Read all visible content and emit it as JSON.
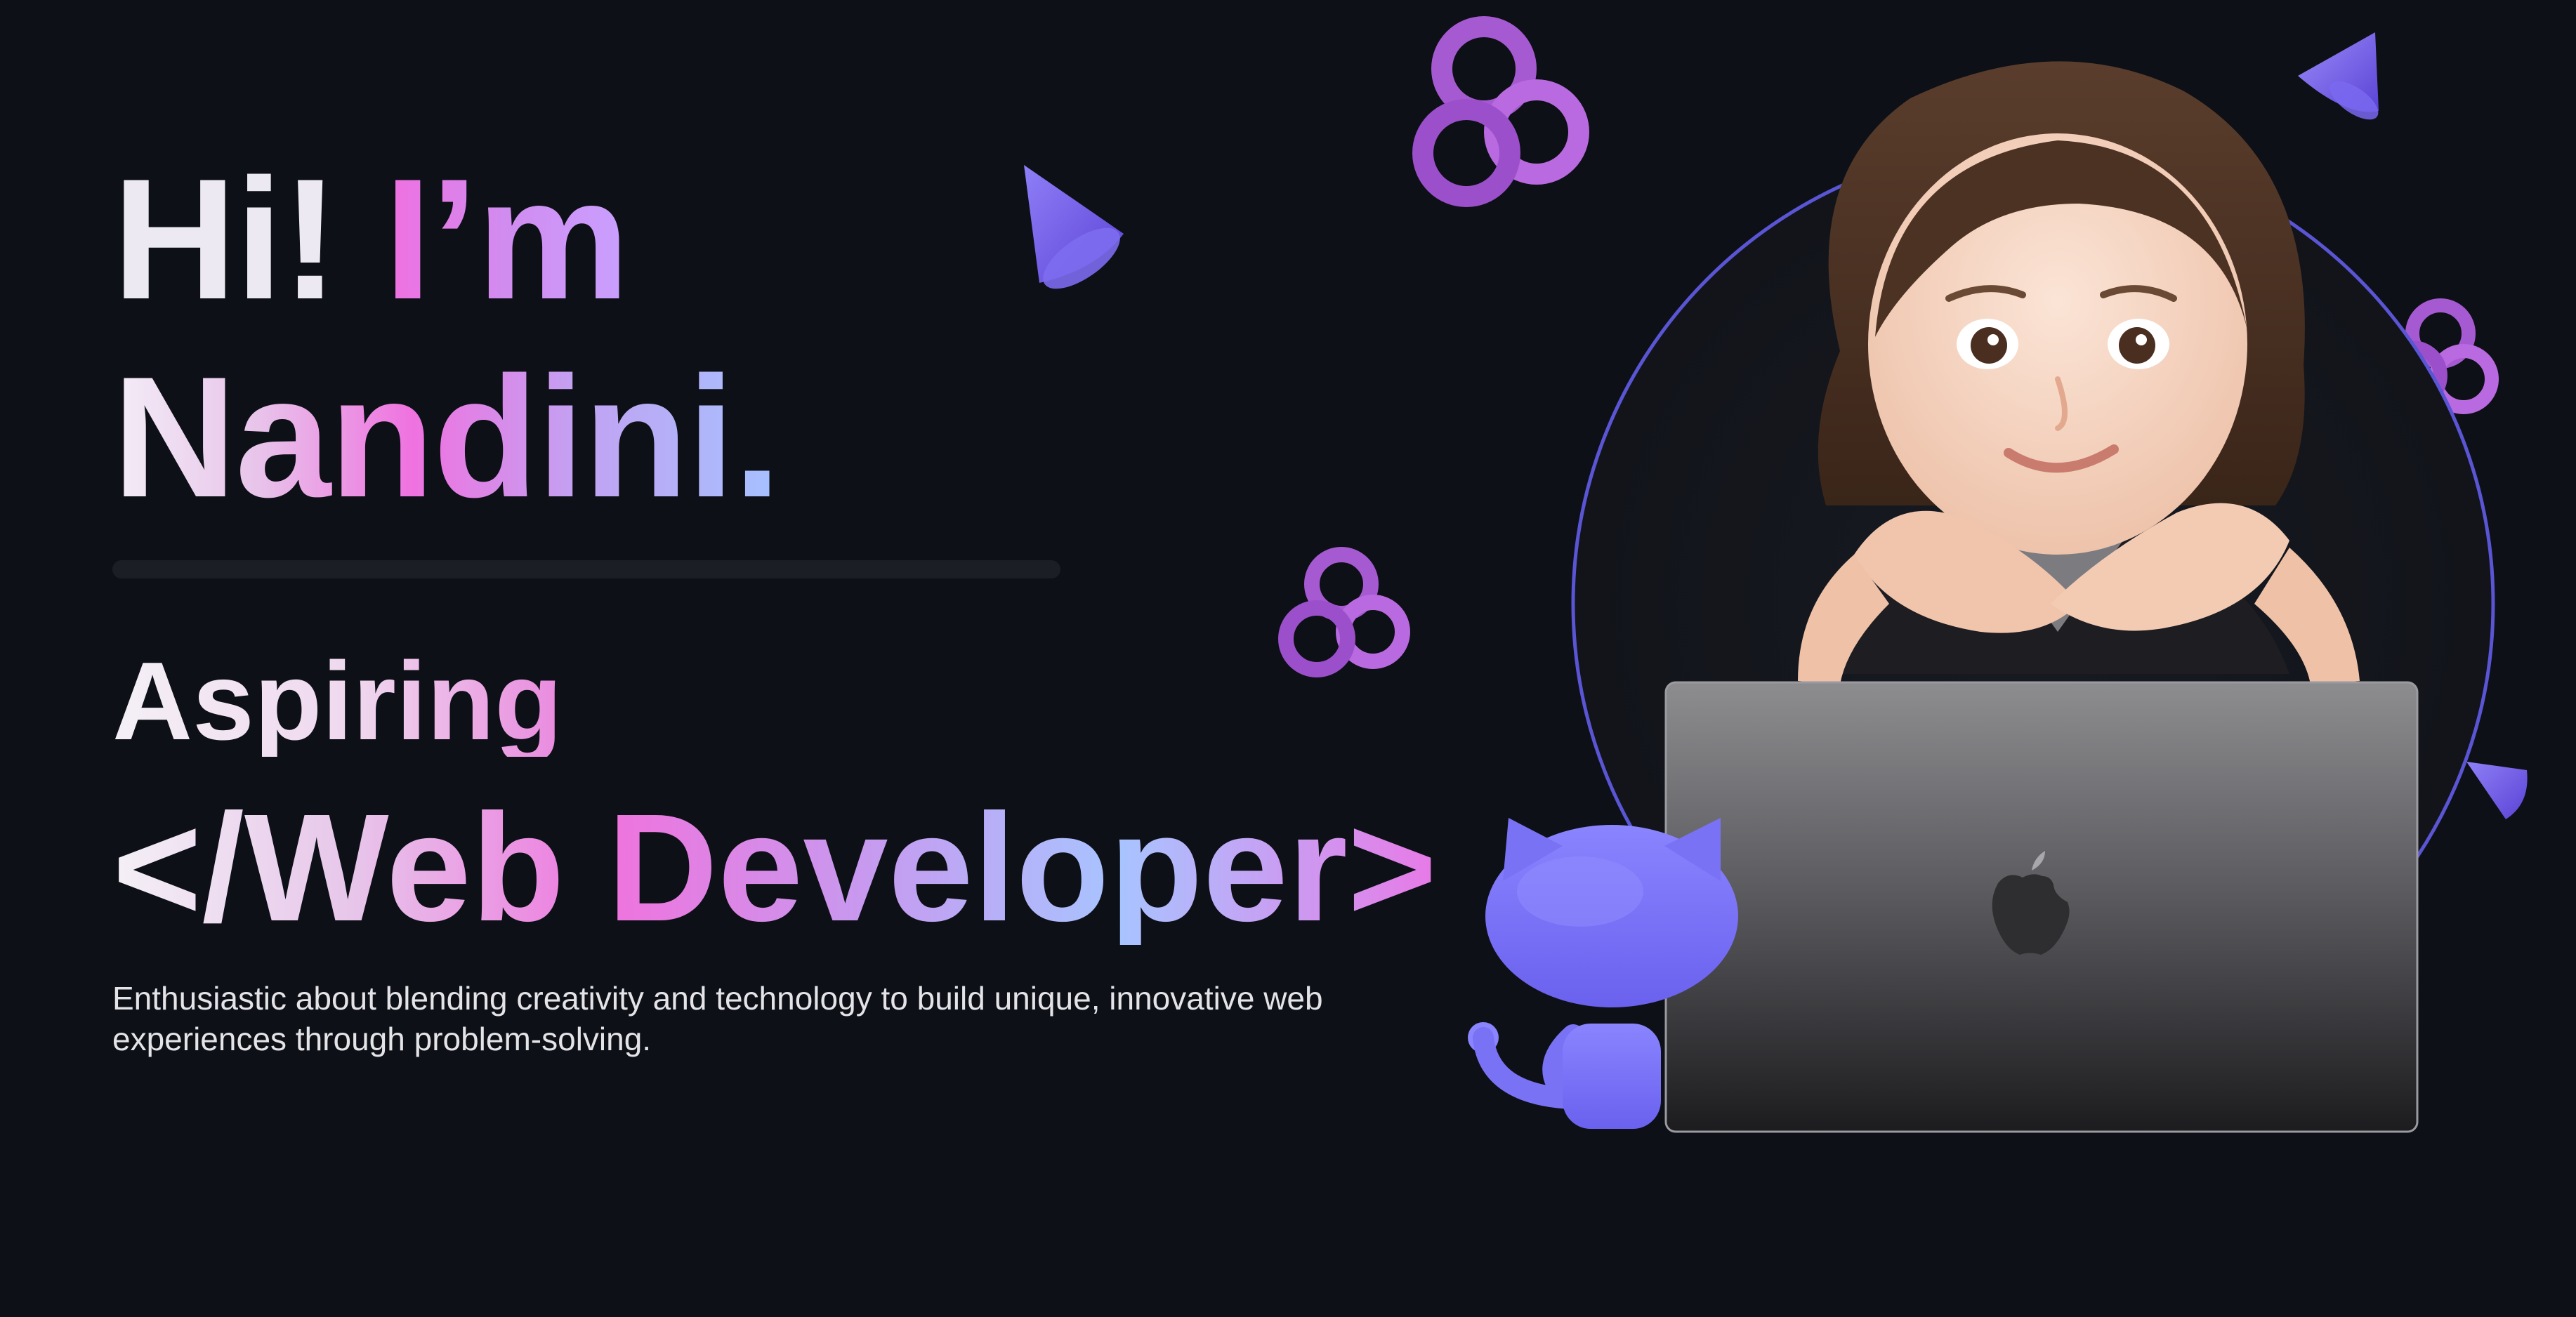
{
  "hero": {
    "greeting": "Hi!",
    "im": "I’m",
    "name": "Nandini.",
    "prefix": "Aspiring",
    "role": "</Web Developer>",
    "description": "Enthusiastic about blending creativity and technology to build unique, innovative web experiences through problem-solving."
  },
  "theme": {
    "background": "#0d1016",
    "accent_pink": "#ef72e0",
    "accent_purple": "#8b5cf6",
    "accent_blue": "#a5c1ff",
    "mascot_color": "#7b73f5"
  },
  "icons": [
    "cone-icon",
    "torus-knot-icon",
    "octocat-icon",
    "laptop-icon",
    "apple-logo-icon",
    "avatar-memoji"
  ]
}
